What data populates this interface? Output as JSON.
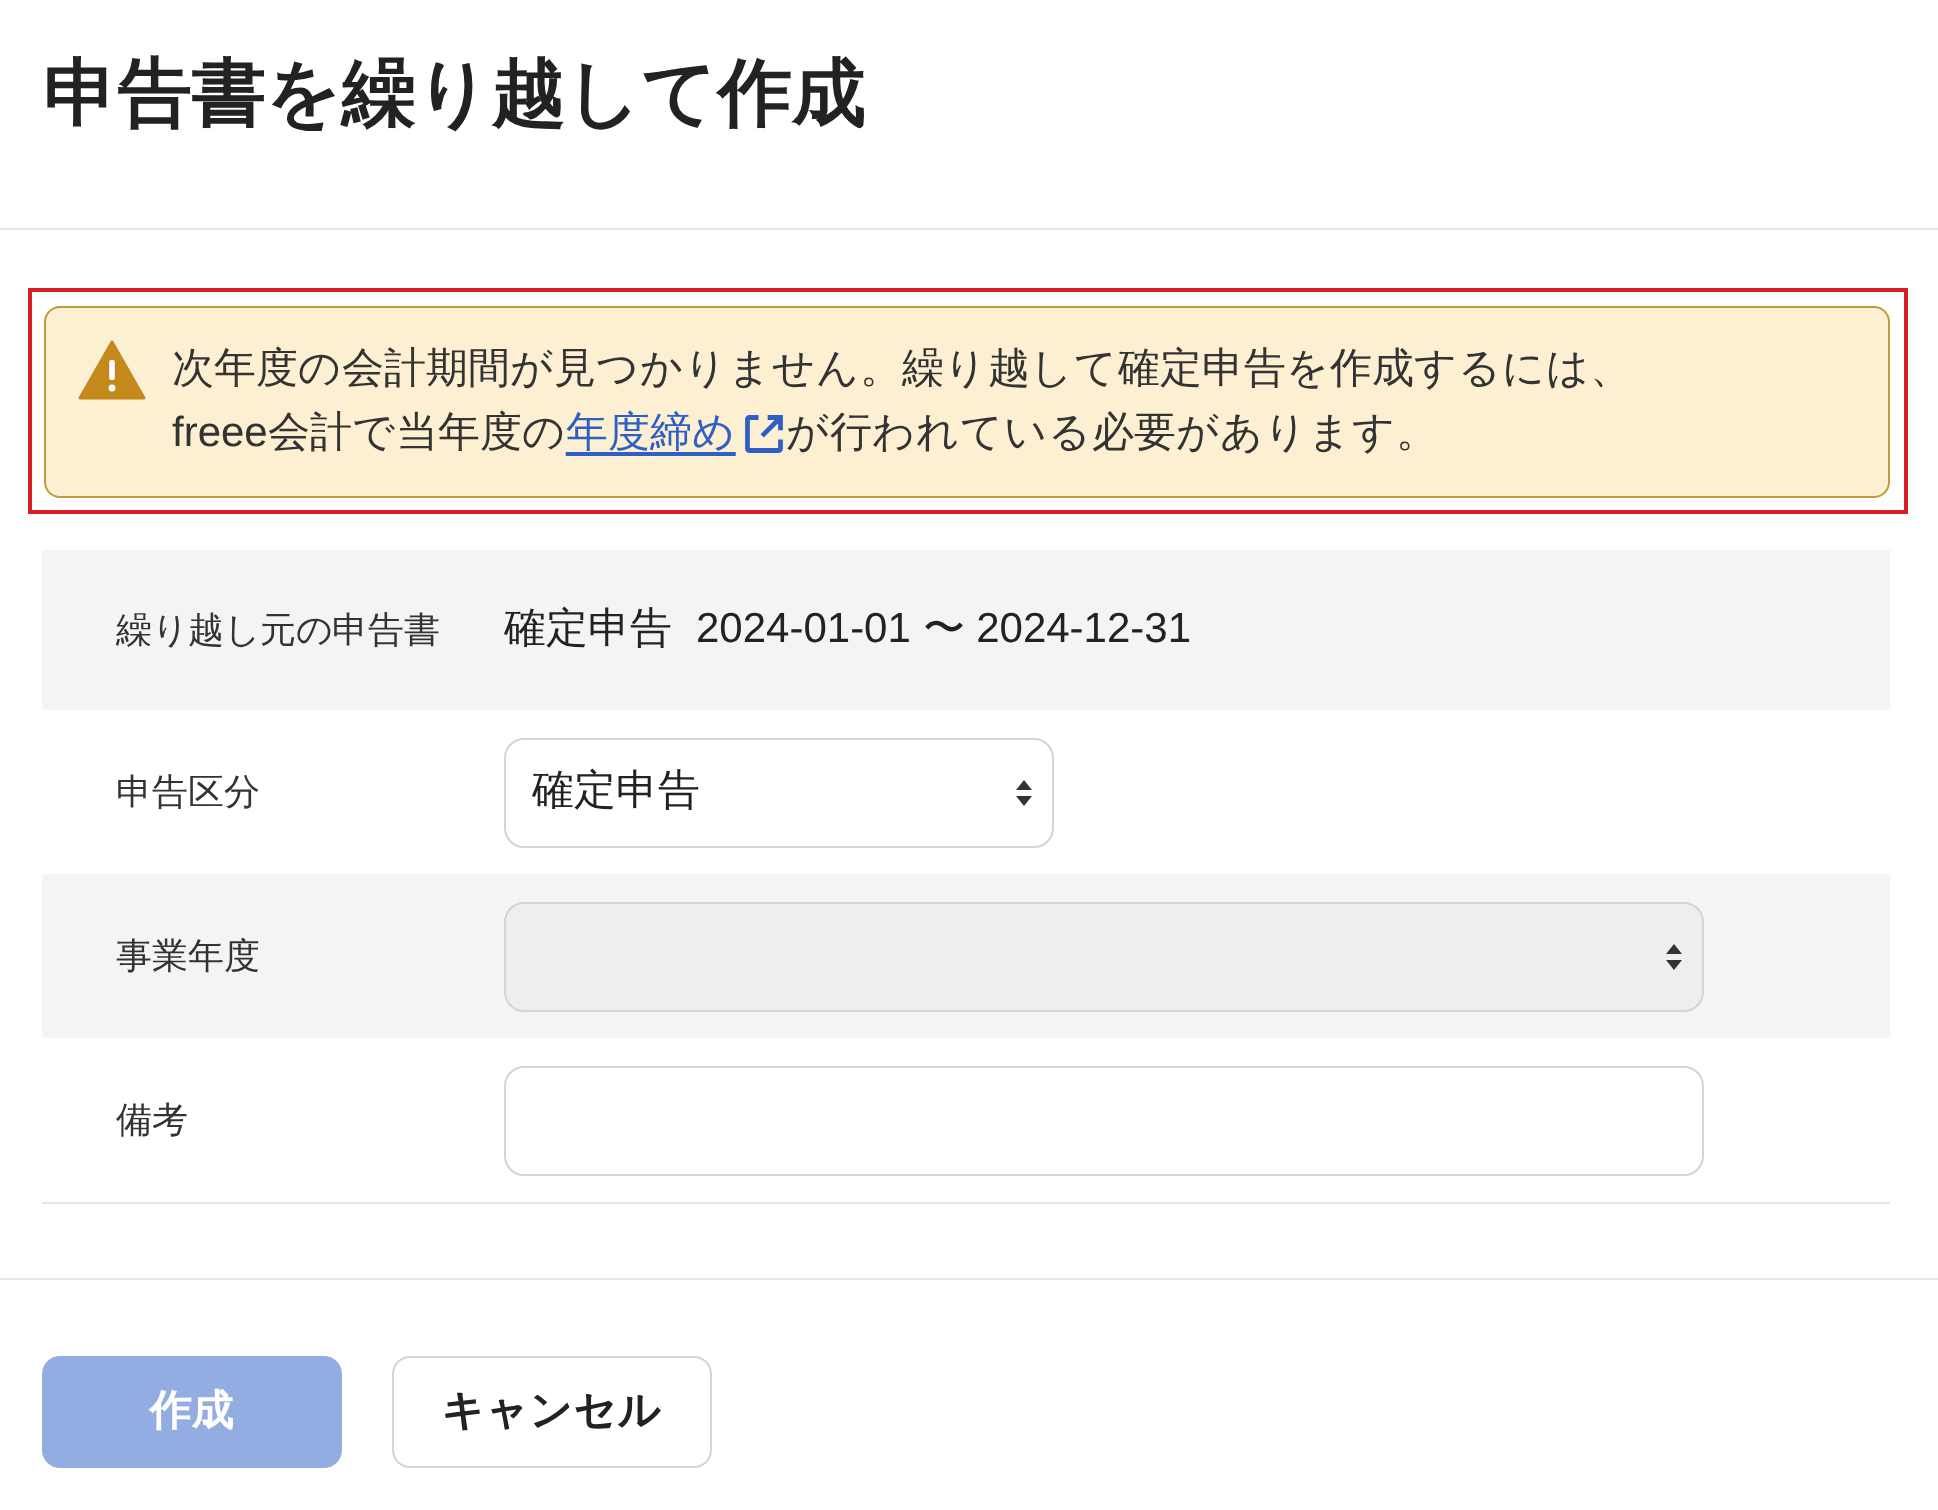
{
  "page": {
    "title": "申告書を繰り越して作成"
  },
  "alert": {
    "kind": "warning",
    "highlighted": true,
    "lines": [
      [
        {
          "kind": "text",
          "text": "次年度の会計期間が見つかりません。繰り越して確定申告を作成するには、"
        }
      ],
      [
        {
          "kind": "text",
          "text": "freee会計で当年度の"
        },
        {
          "kind": "link",
          "text": "年度締め",
          "external": true
        },
        {
          "kind": "text",
          "text": "が行われている必要があります。"
        }
      ]
    ]
  },
  "form": {
    "rows": [
      {
        "label": "繰り越し元の申告書",
        "kind": "text",
        "value": "確定申告",
        "period": "2024-01-01 〜 2024-12-31"
      },
      {
        "label": "申告区分",
        "kind": "select",
        "value": "確定申告",
        "disabled": false
      },
      {
        "label": "事業年度",
        "kind": "select",
        "disabled": true
      },
      {
        "label": "備考",
        "kind": "input"
      }
    ]
  },
  "buttons": [
    {
      "label": "作成",
      "kind": "primary",
      "disabled": true
    },
    {
      "label": "キャンセル",
      "kind": "secondary",
      "disabled": false
    }
  ]
}
